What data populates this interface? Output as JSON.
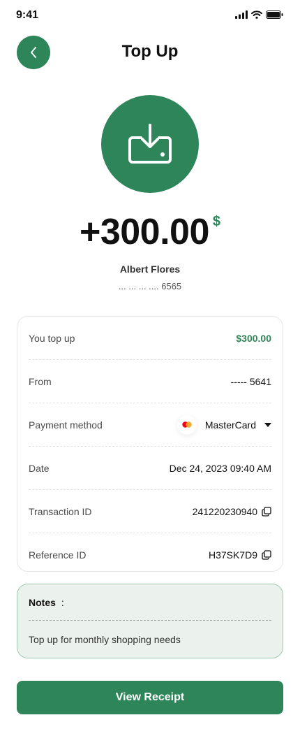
{
  "status_bar": {
    "time": "9:41"
  },
  "header": {
    "title": "Top Up"
  },
  "summary": {
    "amount": "+300.00",
    "currency_symbol": "$",
    "name": "Albert Flores",
    "account_masked": "... ... ... .... 6565"
  },
  "details": [
    {
      "label": "You top up",
      "value": "$300.00"
    },
    {
      "label": "From",
      "value": "----- 5641"
    },
    {
      "label": "Payment method",
      "value": "MasterCard"
    },
    {
      "label": "Date",
      "value": "Dec 24, 2023 09:40 AM"
    },
    {
      "label": "Transaction ID",
      "value": "241220230940"
    },
    {
      "label": "Reference ID",
      "value": "H37SK7D9"
    }
  ],
  "notes": {
    "label": "Notes",
    "separator": ":",
    "text": "Top up for monthly shopping needs"
  },
  "actions": {
    "view_receipt": "View Receipt"
  },
  "icons": {
    "back": "chevron-left-icon",
    "hero": "download-tray-icon",
    "copy": "copy-icon",
    "mastercard": "mastercard-icon",
    "dropdown": "caret-down-icon"
  },
  "colors": {
    "primary": "#2f855a",
    "notes_bg": "#ebf2ee",
    "notes_border": "#9fc8b1",
    "mastercard_red": "#eb001b",
    "mastercard_orange": "#f79e1b"
  }
}
